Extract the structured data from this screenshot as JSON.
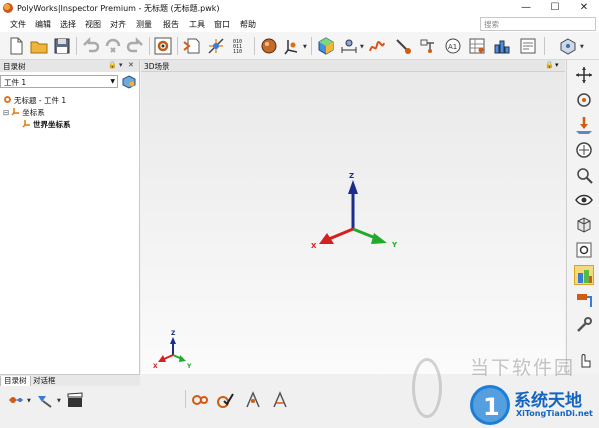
{
  "window": {
    "title": "PolyWorks|Inspector Premium - 无标题 (无标题.pwk)",
    "min_glyph": "—",
    "max_glyph": "☐",
    "close_glyph": "✕"
  },
  "menu": [
    "文件",
    "编辑",
    "选择",
    "视图",
    "对齐",
    "测量",
    "报告",
    "工具",
    "窗口",
    "帮助"
  ],
  "search": {
    "placeholder": "搜索"
  },
  "left_panel": {
    "title": "目录树",
    "controls": {
      "pin": "🔒",
      "arrow": "▾",
      "close": "✕"
    },
    "part_select": {
      "value": "工件 1"
    },
    "tree": [
      {
        "label": "无标题 - 工件 1",
        "icon": "part-icon"
      },
      {
        "label": "坐标系",
        "icon": "coordinate-system-icon",
        "expander": "⊟"
      },
      {
        "label": "世界坐标系",
        "icon": "world-axis-icon"
      }
    ]
  },
  "viewport": {
    "title": "3D场景",
    "axis_labels": {
      "x": "X",
      "y": "Y",
      "z": "Z"
    }
  },
  "bottom_tabs": [
    "目录树",
    "对话框"
  ],
  "watermark": {
    "gray_text": "当下软件园",
    "brand": "系统天地",
    "url": "XiTongTianDi.net",
    "logo_letter": "1"
  },
  "colors": {
    "axis_x": "#d42020",
    "axis_y": "#1faa2a",
    "axis_z": "#1a2c8c",
    "active_tool": "#f5d97a",
    "watermark_blue": "#1565c0"
  }
}
